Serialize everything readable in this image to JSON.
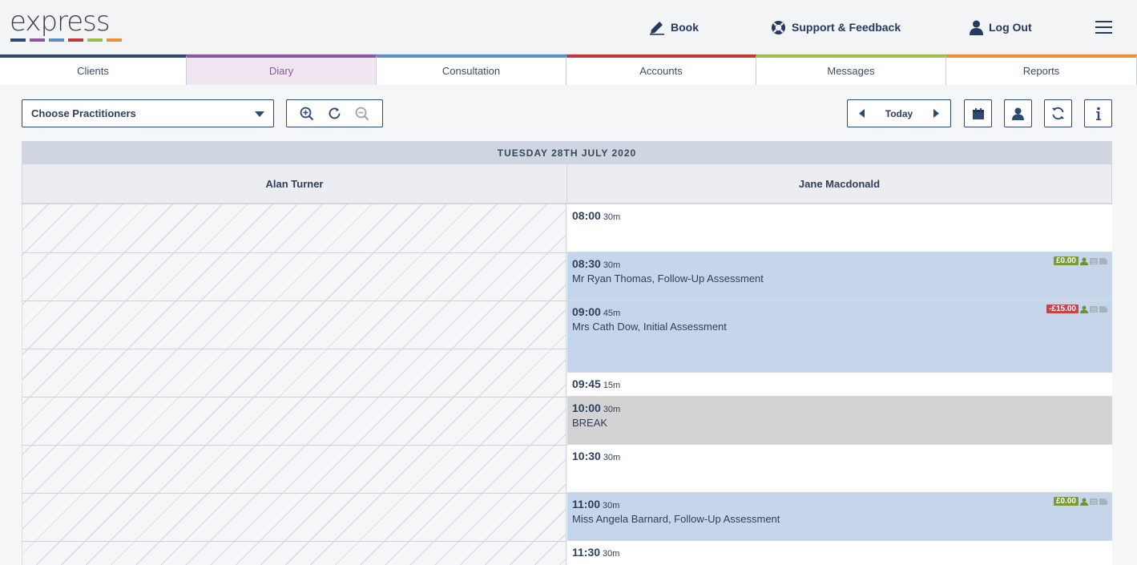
{
  "header": {
    "logo_text": "express",
    "logo_colors": [
      "#2d4a72",
      "#8a57a0",
      "#5b8ec9",
      "#c0383a",
      "#9bbf4a",
      "#ef8f2e"
    ],
    "book_label": "Book",
    "support_label": "Support & Feedback",
    "logout_label": "Log Out"
  },
  "tabs": [
    {
      "label": "Clients",
      "color": "#2d4a72"
    },
    {
      "label": "Diary",
      "color": "#8a57a0"
    },
    {
      "label": "Consultation",
      "color": "#5b8ec9"
    },
    {
      "label": "Accounts",
      "color": "#c0383a"
    },
    {
      "label": "Messages",
      "color": "#9bbf4a"
    },
    {
      "label": "Reports",
      "color": "#ef8f2e"
    }
  ],
  "toolbar": {
    "practitioner_select": "Choose Practitioners",
    "today_label": "Today"
  },
  "calendar": {
    "date_title": "TUESDAY 28TH JULY 2020",
    "practitioners": [
      "Alan Turner",
      "Jane Macdonald"
    ],
    "slots": [
      {
        "time": "08:00",
        "duration": "30m",
        "type": "free",
        "description": "",
        "price": ""
      },
      {
        "time": "08:30",
        "duration": "30m",
        "type": "appt",
        "description": "Mr Ryan Thomas, Follow-Up Assessment",
        "price": "£0.00",
        "price_color": "#7a9a3a"
      },
      {
        "time": "09:00",
        "duration": "45m",
        "type": "appt",
        "description": "Mrs Cath Dow, Initial Assessment",
        "price": "-£15.00",
        "price_color": "#c0464a"
      },
      {
        "time": "09:45",
        "duration": "15m",
        "type": "free",
        "description": "",
        "price": ""
      },
      {
        "time": "10:00",
        "duration": "30m",
        "type": "break",
        "description": "BREAK",
        "price": ""
      },
      {
        "time": "10:30",
        "duration": "30m",
        "type": "free",
        "description": "",
        "price": ""
      },
      {
        "time": "11:00",
        "duration": "30m",
        "type": "appt",
        "description": "Miss Angela Barnard, Follow-Up Assessment",
        "price": "£0.00",
        "price_color": "#7a9a3a"
      },
      {
        "time": "11:30",
        "duration": "30m",
        "type": "free",
        "description": "",
        "price": ""
      }
    ]
  }
}
